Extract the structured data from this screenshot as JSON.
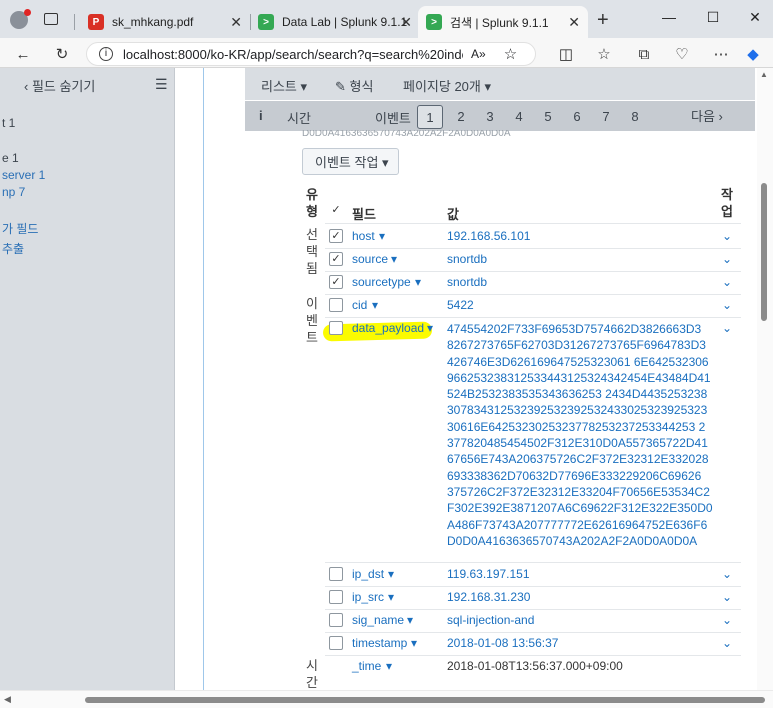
{
  "browser": {
    "tabs": [
      {
        "title": "sk_mhkang.pdf",
        "icon": "pdf-icon"
      },
      {
        "title": "Data Lab | Splunk 9.1.1",
        "icon": "splunk-icon"
      },
      {
        "title": "검색 | Splunk 9.1.1",
        "icon": "splunk-icon"
      }
    ],
    "url": "localhost:8000/ko-KR/app/search/search?q=search%20index%..."
  },
  "sidebar": {
    "toggle_label": "‹ 필드 숨기기",
    "items": [
      "t 1",
      "e 1",
      "server 1",
      "np 7",
      "가 필드",
      "추출"
    ]
  },
  "toolbar": {
    "list_label": "리스트 ▾",
    "format_label": "✎ 형식",
    "per_page_label": "페이지당 20개 ▾",
    "col_time": "시간",
    "col_event": "이벤트",
    "pages": [
      "1",
      "2",
      "3",
      "4",
      "5",
      "6",
      "7",
      "8"
    ],
    "current_page": "1",
    "next_label": "다음 ›",
    "overflow_text": "D0D0A4163636570743A202A2F2A0D0A0D0A"
  },
  "event_action_button": "이벤트 작업 ▾",
  "table": {
    "headers": {
      "type": "유형",
      "field": "필드",
      "value": "값",
      "action": "작업"
    },
    "sections": [
      {
        "label": "선택됨",
        "rows": [
          {
            "field": "host",
            "value": "192.168.56.101",
            "checked": true
          },
          {
            "field": "source",
            "value": "snortdb",
            "checked": true
          },
          {
            "field": "sourcetype",
            "value": "snortdb",
            "checked": true
          }
        ]
      },
      {
        "label": "이벤트",
        "rows": [
          {
            "field": "cid",
            "value": "5422",
            "checked": false
          },
          {
            "field": "data_payload",
            "value": "474554202F733F69653D7574662D3826663D38267273765F62703D31267273765F6964783D3426746E3D6261696475253230616E64253230966253238312533443125324342454E43484D41524B25323835353436362532434D4435253238307834312532392532392532433025323925323061616E64253230253237782532372533442532377820485454502F312E310D0A557365722D4167656E743A206375726C2F372E32312E332028693338362D70632D77696E333229206C6962637375726C2F372E32312E33204F70656E53534C2F302E392E3871207A6C69622F312E322E350D0A486F73743A207777772E62616964752E636F6D0D0A4163636570743A202A2F2A0D0A0D0A",
            "checked": false
          },
          {
            "field": "ip_dst",
            "value": "119.63.197.151",
            "checked": false
          },
          {
            "field": "ip_src",
            "value": "192.168.31.230",
            "checked": false
          },
          {
            "field": "sig_name",
            "value": "sql-injection-and",
            "checked": false
          },
          {
            "field": "timestamp",
            "value": "2018-01-08 13:56:37",
            "checked": false
          }
        ]
      },
      {
        "label": "시간",
        "rows": [
          {
            "field": "_time",
            "value": "2018-01-08T13:56:37.000+09:00",
            "checked": false
          }
        ]
      }
    ]
  },
  "payload_lines": [
    "474554202F733F69653D7574662D3826663D3",
    "8267273765F62703D31267273765F6964783D3",
    "426746E3D626169647525323061 6E642532306",
    "966253238312533443125324342454E43484D41",
    "524B2532383535343636253 2434D4435253238",
    "307834312532392532392532433025323925323",
    "30616E6425323025323778253237253344253 2",
    "377820485454502F312E310D0A557365722D41",
    "67656E743A206375726C2F372E32312E332028",
    "693338362D70632D77696E333229206C69626",
    "375726C2F372E32312E33204F70656E53534C2",
    "F302E392E3871207A6C69622F312E322E350D0",
    "A486F73743A207777772E62616964752E636F6",
    "D0D0A4163636570743A202A2F2A0D0A0D0A"
  ]
}
